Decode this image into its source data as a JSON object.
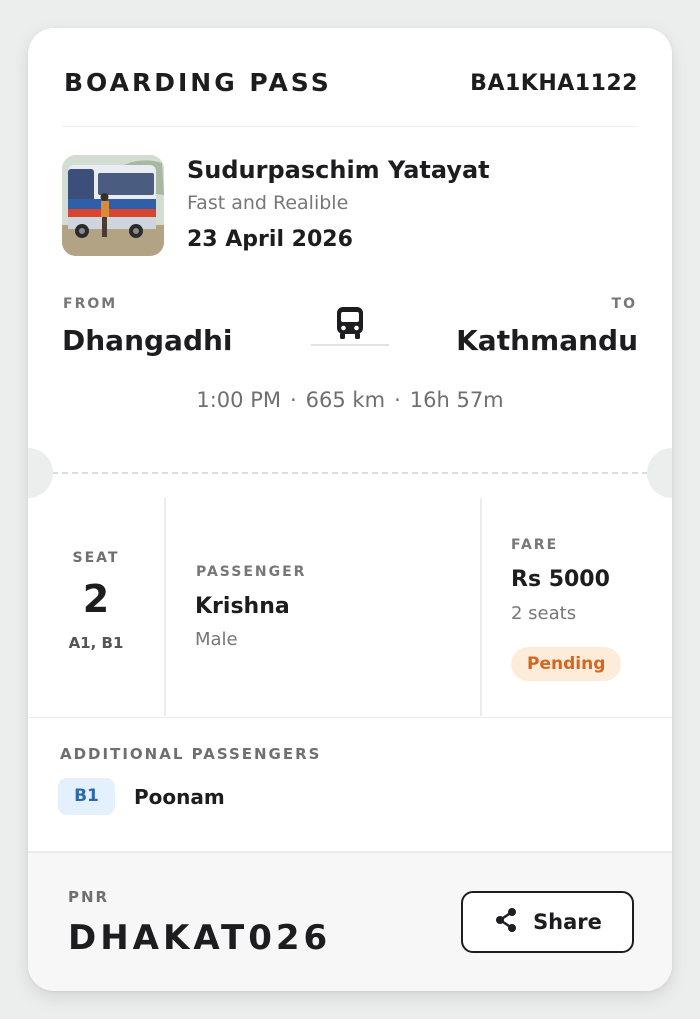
{
  "header": {
    "title": "BOARDING PASS",
    "booking_code": "BA1KHA1122"
  },
  "operator": {
    "name": "Sudurpaschim Yatayat",
    "tagline": "Fast and Realible",
    "date": "23 April 2026",
    "photo_icon": "bus-photo"
  },
  "route": {
    "from_label": "FROM",
    "from_city": "Dhangadhi",
    "to_label": "TO",
    "to_city": "Kathmandu",
    "icon": "bus-icon",
    "departure_time": "1:00 PM",
    "distance": "665 km",
    "duration": "16h 57m",
    "separator": "·"
  },
  "seat": {
    "label": "SEAT",
    "count": "2",
    "seats": "A1, B1"
  },
  "passenger": {
    "label": "PASSENGER",
    "name": "Krishna",
    "gender": "Male"
  },
  "fare": {
    "label": "FARE",
    "amount": "Rs 5000",
    "seats_text": "2 seats",
    "status": "Pending",
    "status_color": "#d4661d",
    "status_bg": "#fdecd9"
  },
  "additional_passengers": {
    "label": "ADDITIONAL PASSENGERS",
    "items": [
      {
        "seat": "B1",
        "name": "Poonam"
      }
    ]
  },
  "footer": {
    "pnr_label": "PNR",
    "pnr": "DHAKAT026",
    "share_label": "Share",
    "share_icon": "share-icon"
  },
  "colors": {
    "page_bg": "#eceeed",
    "card_bg": "#ffffff",
    "text_primary": "#1d1d1f",
    "text_muted": "#777777",
    "chip_bg": "#e4f0fb",
    "chip_text": "#2a6aaa"
  }
}
